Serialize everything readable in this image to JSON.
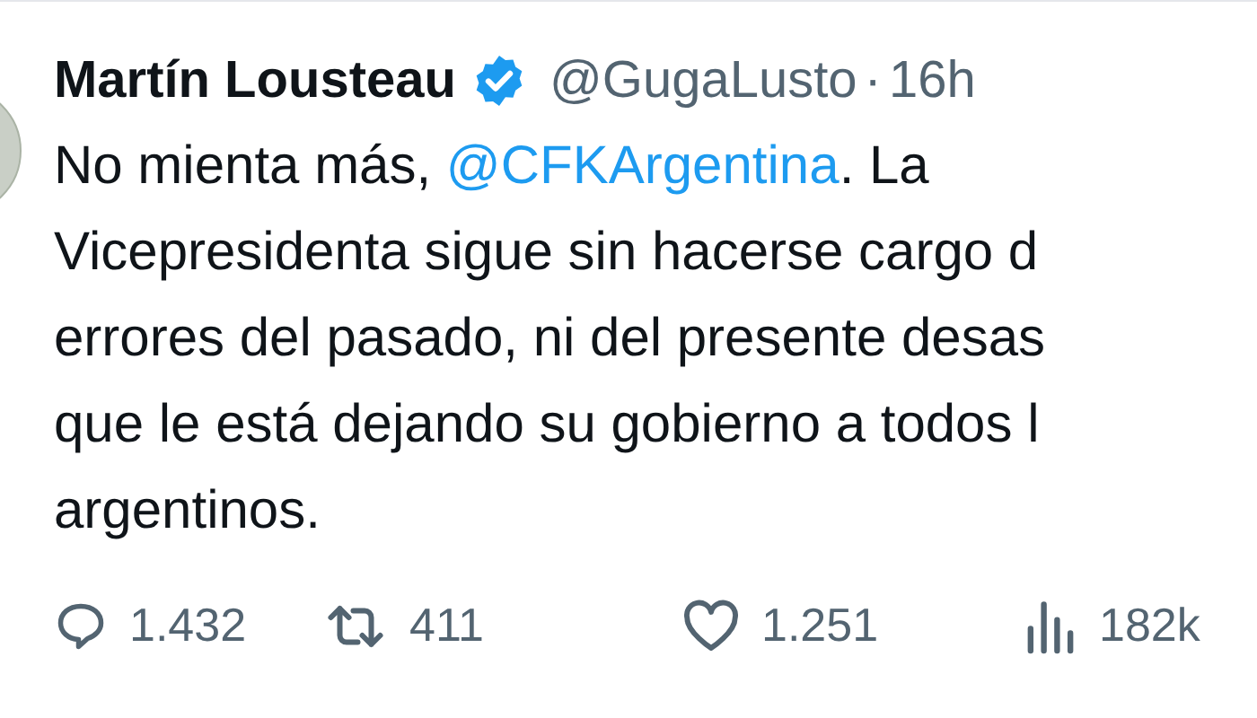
{
  "tweet": {
    "author": {
      "name": "Martín Lousteau",
      "verified": true,
      "handle": "@GugaLusto",
      "separator": "·",
      "time": "16h"
    },
    "first_line": {
      "before": "No mienta más, ",
      "mention": "@CFKArgentina",
      "after": ". La"
    },
    "lines": [
      "Vicepresidenta sigue sin hacerse cargo d",
      "errores del pasado, ni del presente desas",
      "que le está dejando su gobierno a todos l",
      "argentinos."
    ],
    "stats": [
      {
        "kind": "reply",
        "count": "1.432"
      },
      {
        "kind": "retweet",
        "count": "411"
      },
      {
        "kind": "like",
        "count": "1.251"
      },
      {
        "kind": "views",
        "count": "182k"
      }
    ]
  }
}
